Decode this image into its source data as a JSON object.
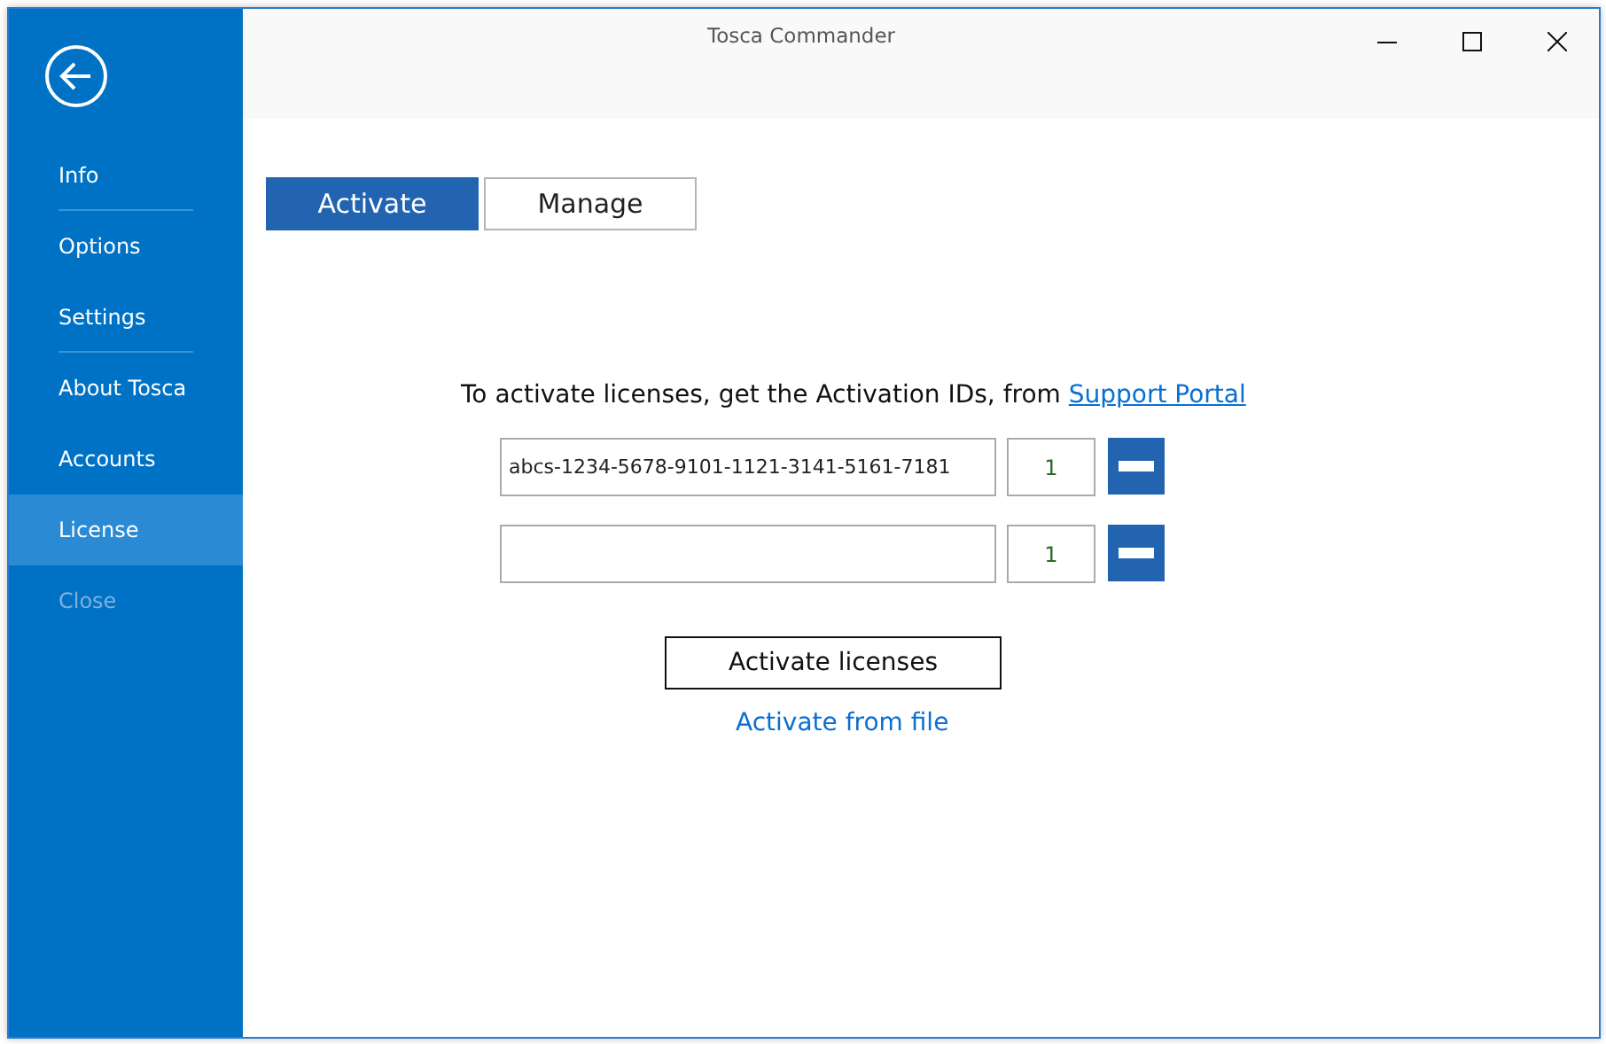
{
  "window": {
    "title": "Tosca Commander"
  },
  "sidebar": {
    "items": [
      {
        "label": "Info",
        "selected": false,
        "disabled": false,
        "separator_below": true
      },
      {
        "label": "Options",
        "selected": false,
        "disabled": false,
        "separator_below": false
      },
      {
        "label": "Settings",
        "selected": false,
        "disabled": false,
        "separator_below": true
      },
      {
        "label": "About Tosca",
        "selected": false,
        "disabled": false,
        "separator_below": false
      },
      {
        "label": "Accounts",
        "selected": false,
        "disabled": false,
        "separator_below": false
      },
      {
        "label": "License",
        "selected": true,
        "disabled": false,
        "separator_below": false
      },
      {
        "label": "Close",
        "selected": false,
        "disabled": true,
        "separator_below": false
      }
    ]
  },
  "tabs": [
    {
      "label": "Activate",
      "selected": true
    },
    {
      "label": "Manage",
      "selected": false
    }
  ],
  "instruction": {
    "text": "To activate licenses, get the Activation IDs, from",
    "link": "Support Portal"
  },
  "license_rows": [
    {
      "activation_id": "abcs-1234-5678-9101-1121-3141-5161-7181",
      "count": "1"
    },
    {
      "count": "1"
    }
  ],
  "buttons": {
    "activate": "Activate licenses",
    "from_file": "Activate from file"
  }
}
